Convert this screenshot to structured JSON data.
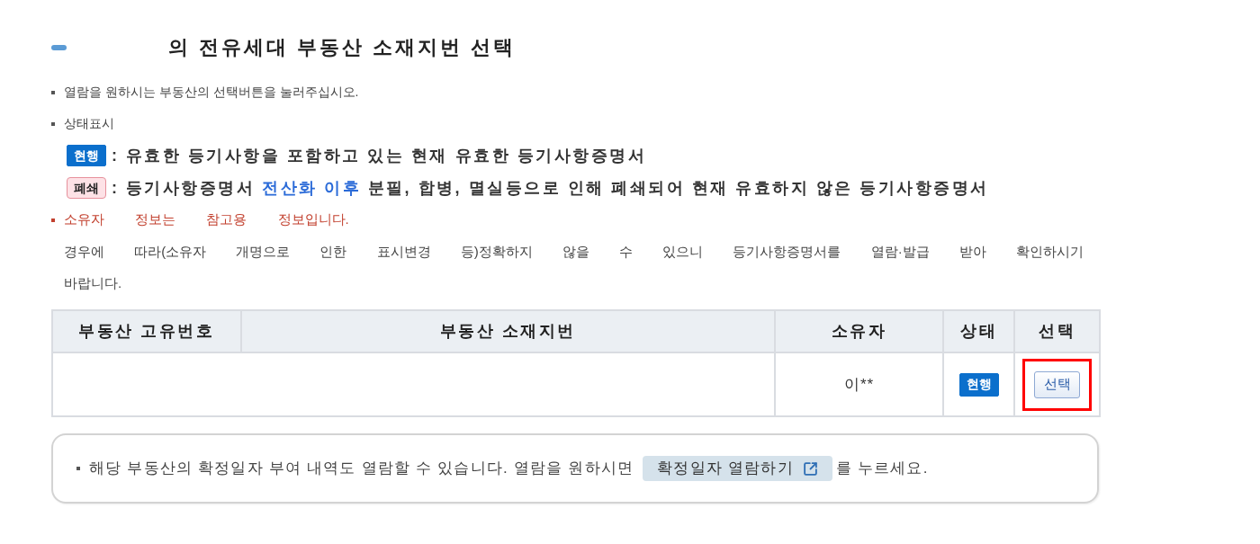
{
  "title": "의 전유세대 부동산 소재지번 선택",
  "instructions": [
    "열람을 원하시는 부동산의 선택버튼을 눌러주십시오.",
    "상태표시"
  ],
  "legend": [
    {
      "kind": "current",
      "badge": "현행",
      "segments": [
        {
          "text": ": 유효한 등기사항을 포함하고 있는 현재 유효한 등기사항증명서",
          "emphasis": false
        }
      ]
    },
    {
      "kind": "closed",
      "badge": "폐쇄",
      "segments": [
        {
          "text": ": 등기사항증명서 ",
          "emphasis": false
        },
        {
          "text": "전산화 이후",
          "emphasis": true
        },
        {
          "text": " 분필, 합병, 멸실등으로 인해 폐쇄되어 현재 유효하지 않은 등기사항증명서",
          "emphasis": false
        }
      ]
    }
  ],
  "owner_notice": {
    "headline": "소유자 정보는 참고용 정보입니다.",
    "detail": "경우에 따라(소유자 개명으로 인한 표시변경 등)정확하지 않을 수 있으니 등기사항증명서를 열람·발급 받아 확인하시기 바랍니다."
  },
  "table": {
    "columns": [
      "부동산 고유번호",
      "부동산 소재지번",
      "소유자",
      "상태",
      "선택"
    ],
    "rows": [
      {
        "owner": "이**",
        "status": {
          "kind": "current",
          "label": "현행"
        },
        "select_button": {
          "label": "선택",
          "highlighted": true
        }
      }
    ]
  },
  "date_notice": {
    "text_before": "해당 부동산의 확정일자 부여 내역도 열람할 수 있습니다. 열람을 원하시면",
    "button": "확정일자 열람하기",
    "text_after": "를 누르세요."
  }
}
